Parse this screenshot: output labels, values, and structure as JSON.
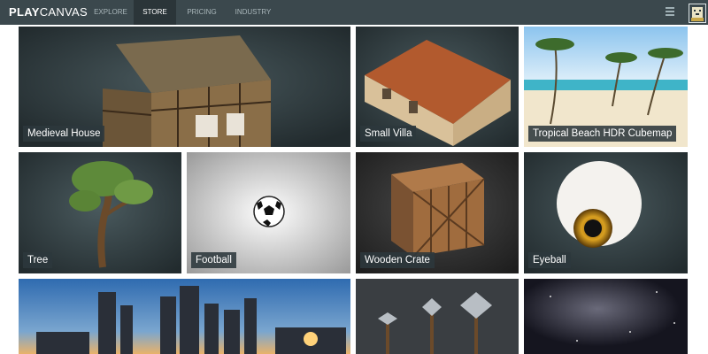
{
  "app": {
    "logo_bold": "PLAY",
    "logo_thin": "CANVAS"
  },
  "nav": {
    "explore": "EXPLORE",
    "store": "STORE",
    "pricing": "PRICING",
    "industry": "INDUSTRY"
  },
  "assets": [
    {
      "name": "Medieval House"
    },
    {
      "name": "Small Villa"
    },
    {
      "name": "Tropical Beach HDR Cubemap"
    },
    {
      "name": "Tree"
    },
    {
      "name": "Football"
    },
    {
      "name": "Wooden Crate"
    },
    {
      "name": "Eyeball"
    }
  ],
  "icons": {
    "menu": "hamburger-menu-icon",
    "avatar": "user-avatar-icon"
  },
  "colors": {
    "topbar": "#3b484d",
    "active_tab": "#2b3539",
    "label_bg": "#2c383c",
    "page_bg": "#ffffff"
  }
}
